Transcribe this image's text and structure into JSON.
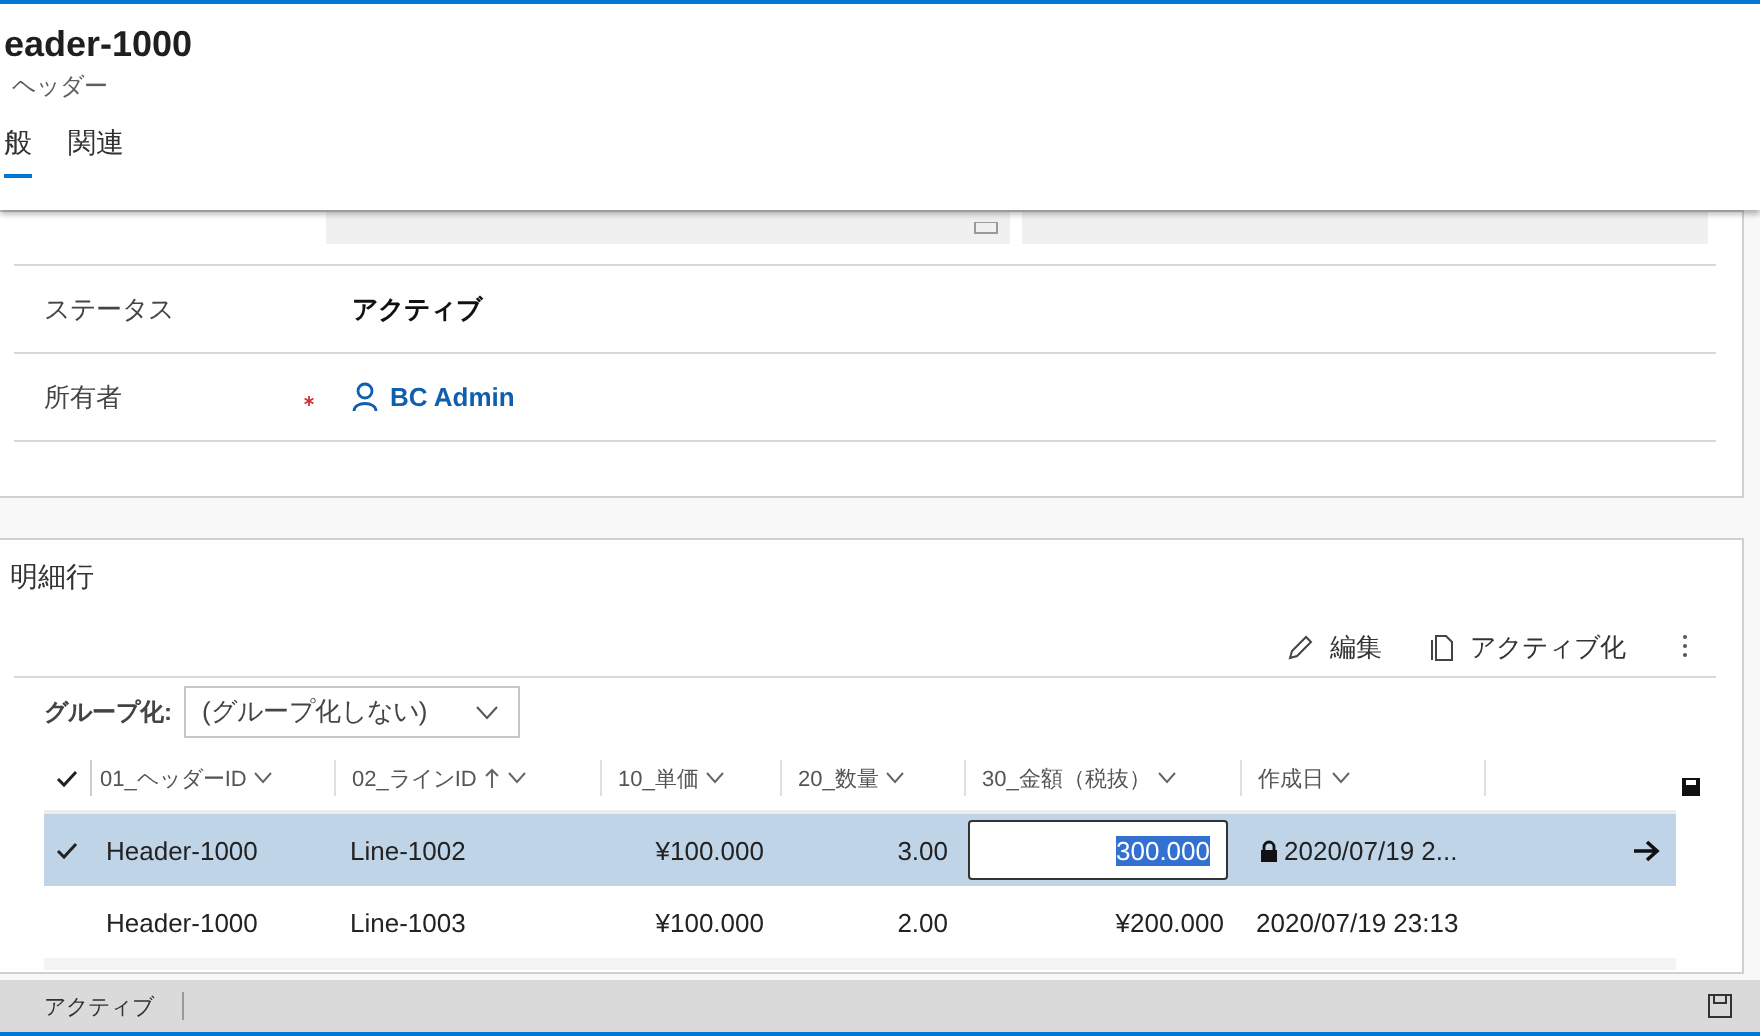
{
  "header": {
    "title": "eader-1000",
    "subtitle": "ヘッダー",
    "tabs": [
      {
        "label": "般",
        "selected": true
      },
      {
        "label": "関連",
        "selected": false
      }
    ]
  },
  "form": {
    "fields": [
      {
        "kind": "text",
        "label": "ステータス",
        "value": "アクティブ",
        "required": false
      },
      {
        "kind": "lookup",
        "label": "所有者",
        "value": "BC Admin",
        "required": true
      }
    ]
  },
  "subgrid": {
    "title": "明細行",
    "commands": [
      {
        "kind": "edit",
        "label": "編集"
      },
      {
        "kind": "activate",
        "label": "アクティブ化"
      }
    ],
    "group_by": {
      "label": "グループ化:",
      "value": "(グループ化しない)"
    },
    "columns": [
      {
        "label": "01_ヘッダーID",
        "sorted": false,
        "kind": "text"
      },
      {
        "label": "02_ラインID",
        "sorted": true,
        "kind": "text"
      },
      {
        "label": "10_単価",
        "sorted": false,
        "kind": "number"
      },
      {
        "label": "20_数量",
        "sorted": false,
        "kind": "number"
      },
      {
        "label": "30_金額（税抜）",
        "sorted": false,
        "kind": "number"
      },
      {
        "label": "作成日",
        "sorted": false,
        "kind": "text"
      }
    ],
    "rows": [
      {
        "selected": true,
        "cells": [
          "Header-1000",
          "Line-1002",
          "¥100.000",
          "3.00",
          "300.000",
          "2020/07/19 2..."
        ]
      },
      {
        "selected": false,
        "cells": [
          "Header-1000",
          "Line-1003",
          "¥100.000",
          "2.00",
          "¥200.000",
          "2020/07/19 23:13"
        ]
      }
    ]
  },
  "status_bar": {
    "status": "アクティブ"
  }
}
